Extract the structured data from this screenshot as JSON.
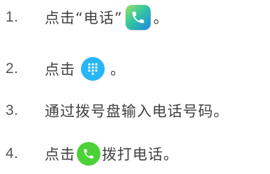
{
  "steps": [
    {
      "number": "1.",
      "text_before": "点击“电话”",
      "icon": "phone-app-icon",
      "text_after": "。"
    },
    {
      "number": "2.",
      "text_before": "点击",
      "icon": "dialpad-icon",
      "text_after": "。"
    },
    {
      "number": "3.",
      "text_before": "通过拨号盘输入电话号码。"
    },
    {
      "number": "4.",
      "text_before": "点击",
      "icon": "call-icon",
      "text_after": "拨打电话。"
    }
  ],
  "colors": {
    "phone_app_gradient": [
      "#9be15d",
      "#33c6a0",
      "#1e88e5"
    ],
    "dialpad_blue": "#29b6f6",
    "call_green": "#4cd137",
    "text": "#404040"
  }
}
